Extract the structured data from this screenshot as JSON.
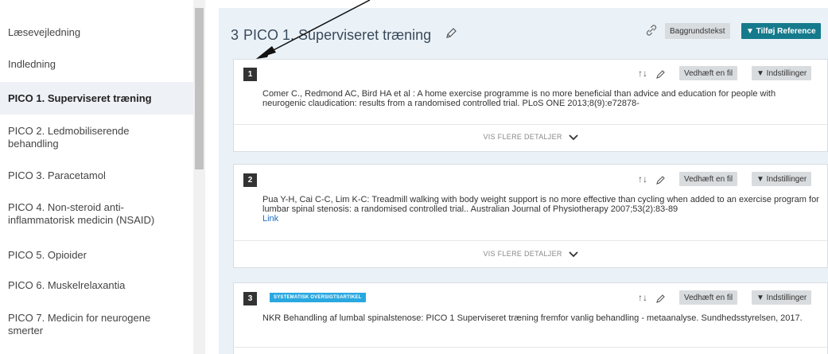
{
  "sidebar": {
    "items": [
      {
        "label": "Læsevejledning"
      },
      {
        "label": "Indledning"
      },
      {
        "label": "PICO 1. Superviseret træning"
      },
      {
        "label": "PICO 2. Ledmobiliserende behandling"
      },
      {
        "label": "PICO 3. Paracetamol"
      },
      {
        "label": "PICO 4. Non-steroid anti-inflammatorisk medicin (NSAID)"
      },
      {
        "label": "PICO 5. Opioider"
      },
      {
        "label": "PICO 6. Muskelrelaxantia"
      },
      {
        "label": "PICO 7. Medicin for neurogene smerter"
      }
    ],
    "active_index": 2
  },
  "section": {
    "number": "3",
    "title": "PICO 1. Superviseret træning",
    "background_button": "Baggrundstekst",
    "add_reference_button": "▼ Tilføj Reference"
  },
  "references": [
    {
      "number": "1",
      "badge": "",
      "text": "Comer C., Redmond AC, Bird HA et al : A home exercise programme is no more beneficial than advice and education for people with neurogenic claudication: results from a randomised controlled trial. PLoS ONE 2013;8(9):e72878-",
      "link": "",
      "attach_button": "Vedhæft en fil",
      "settings_button": "▼ Indstillinger",
      "details_label": "VIS FLERE DETALJER"
    },
    {
      "number": "2",
      "badge": "",
      "text": "Pua Y-H, Cai C-C, Lim K-C: Treadmill walking with body weight support is no more effective than cycling when added to an exercise program for lumbar spinal stenosis: a randomised controlled trial.. Australian Journal of Physiotherapy 2007;53(2):83-89",
      "link": "Link",
      "attach_button": "Vedhæft en fil",
      "settings_button": "▼ Indstillinger",
      "details_label": "VIS FLERE DETALJER"
    },
    {
      "number": "3",
      "badge": "SYSTEMATISK OVERSIGTSARTIKEL",
      "text": "NKR Behandling af lumbal spinalstenose: PICO 1 Superviseret træning fremfor vanlig behandling - metaanalyse. Sundhedsstyrelsen, 2017.",
      "link": "",
      "attach_button": "Vedhæft en fil",
      "settings_button": "▼ Indstillinger",
      "details_label": ""
    }
  ],
  "colors": {
    "accent": "#157a8c",
    "badge": "#29a8e0",
    "panel_bg": "#eaf2f8",
    "active_item_bg": "#eef1f5",
    "link": "#1a6dc4"
  },
  "icons": {
    "title_edit": "pencil-icon",
    "link": "link-icon",
    "sort": "sort-icon",
    "edit": "pencil-icon",
    "details": "chevron-down-icon"
  }
}
